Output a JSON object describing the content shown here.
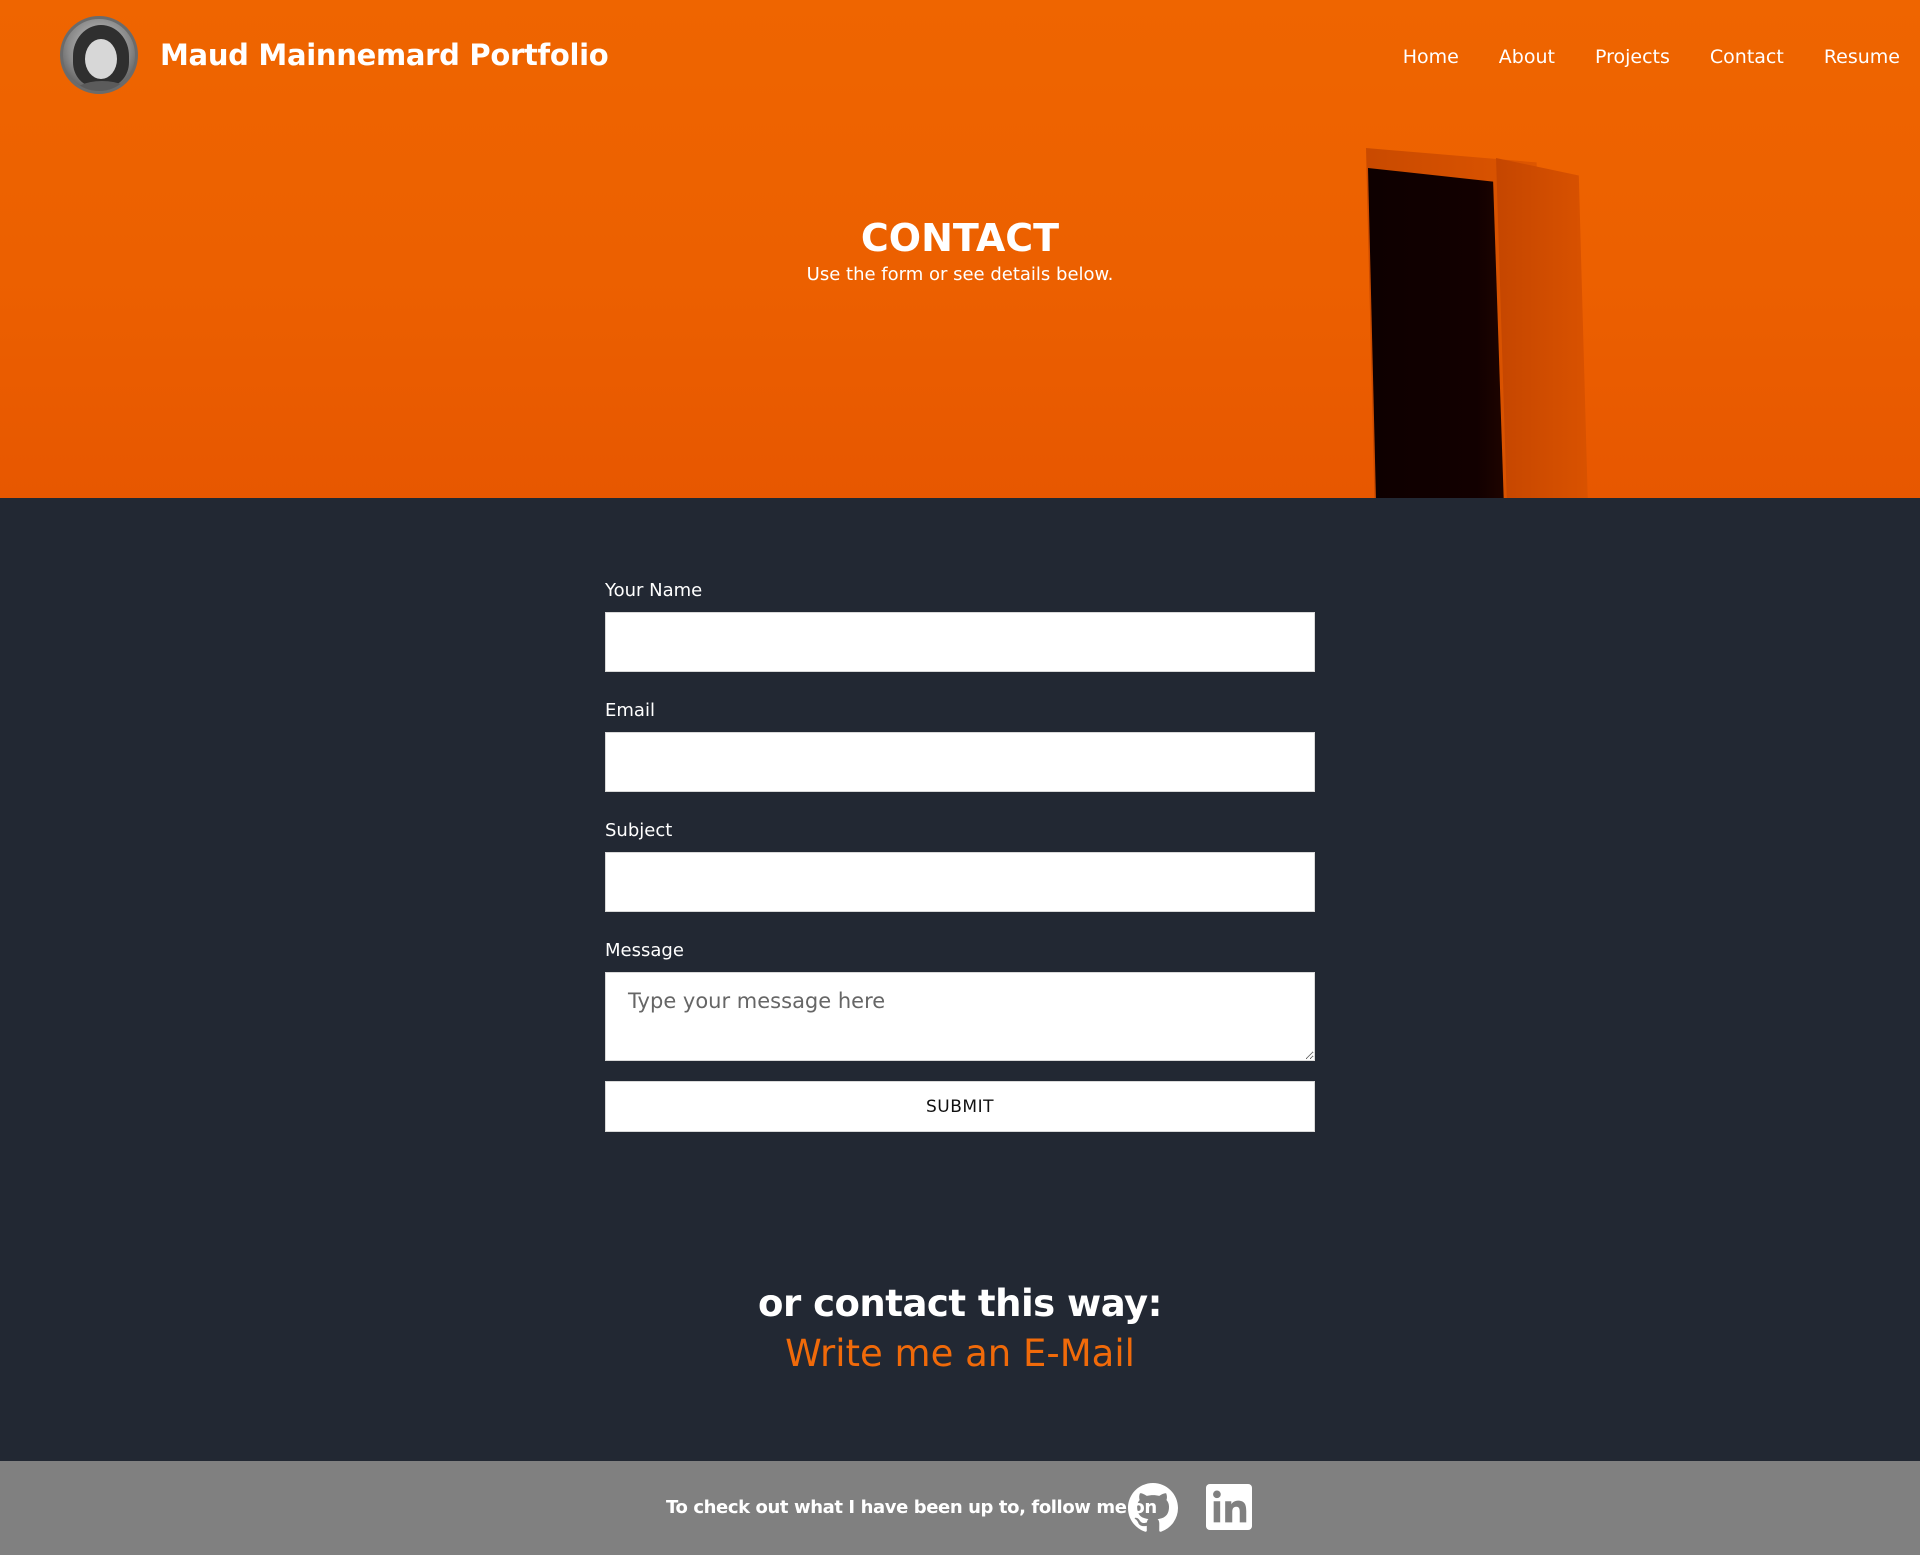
{
  "header": {
    "brand": "Maud Mainnemard Portfolio",
    "nav": [
      "Home",
      "About",
      "Projects",
      "Contact",
      "Resume"
    ]
  },
  "hero": {
    "title": "CONTACT",
    "subtitle": "Use the form or see details below."
  },
  "form": {
    "name_label": "Your Name",
    "email_label": "Email",
    "subject_label": "Subject",
    "message_label": "Message",
    "message_placeholder": "Type your message here",
    "submit_label": "SUBMIT"
  },
  "alt_contact": {
    "title": "or contact this way:",
    "email_link": "Write me an E-Mail"
  },
  "footer": {
    "text": "To check out what I have been up to, follow me on",
    "icons": [
      "github-icon",
      "linkedin-icon"
    ]
  },
  "colors": {
    "hero_orange": "#ef6500",
    "page_bg": "#222833",
    "link_orange": "#f06a0a",
    "footer_bg": "#808080"
  }
}
